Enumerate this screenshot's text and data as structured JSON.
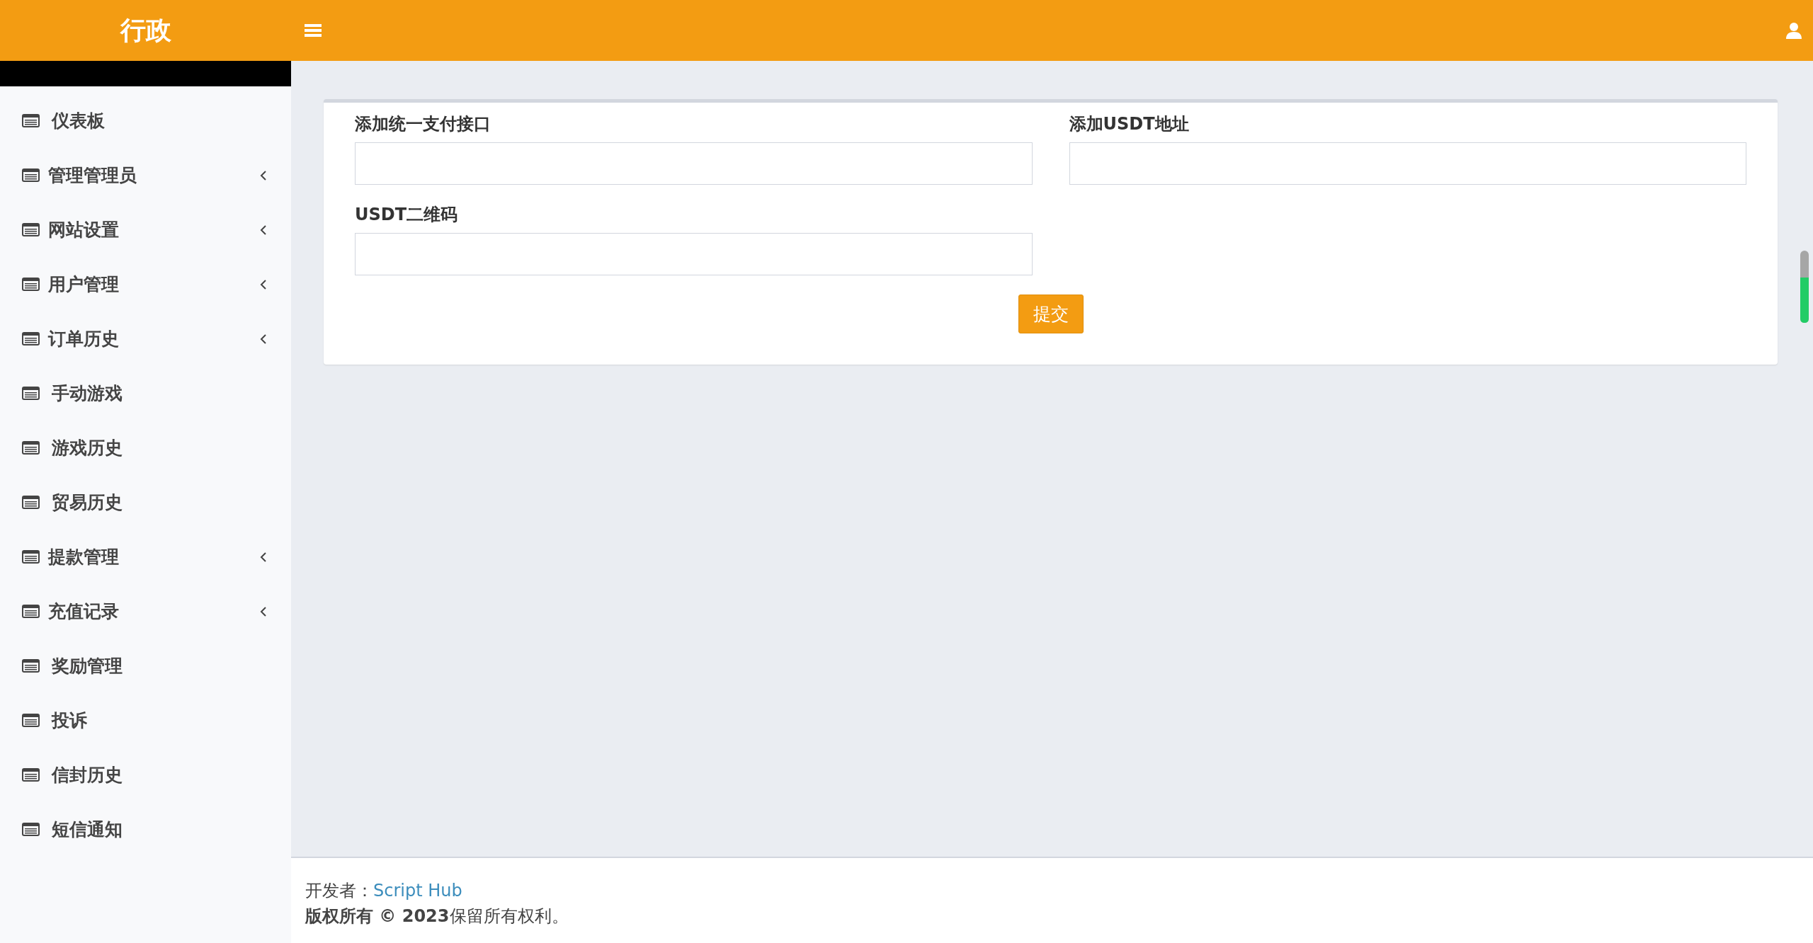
{
  "header": {
    "brand": "行政"
  },
  "sidebar": {
    "items": [
      {
        "label": "仪表板",
        "submenu": false
      },
      {
        "label": "管理管理员",
        "submenu": true
      },
      {
        "label": "网站设置",
        "submenu": true
      },
      {
        "label": "用户管理",
        "submenu": true
      },
      {
        "label": "订单历史",
        "submenu": true
      },
      {
        "label": "手动游戏",
        "submenu": false
      },
      {
        "label": "游戏历史",
        "submenu": false
      },
      {
        "label": "贸易历史",
        "submenu": false
      },
      {
        "label": "提款管理",
        "submenu": true
      },
      {
        "label": "充值记录",
        "submenu": true
      },
      {
        "label": "奖励管理",
        "submenu": false
      },
      {
        "label": "投诉",
        "submenu": false
      },
      {
        "label": "信封历史",
        "submenu": false
      },
      {
        "label": "短信通知",
        "submenu": false
      }
    ]
  },
  "form": {
    "fields": [
      {
        "label": "添加统一支付接口"
      },
      {
        "label": "添加USDT地址"
      },
      {
        "label": "USDT二维码"
      }
    ],
    "submit": "提交"
  },
  "footer": {
    "developer_label": "开发者：",
    "developer_link": "Script Hub",
    "copyright_bold": "版权所有 © 2023",
    "copyright_rest": "保留所有权利。"
  }
}
